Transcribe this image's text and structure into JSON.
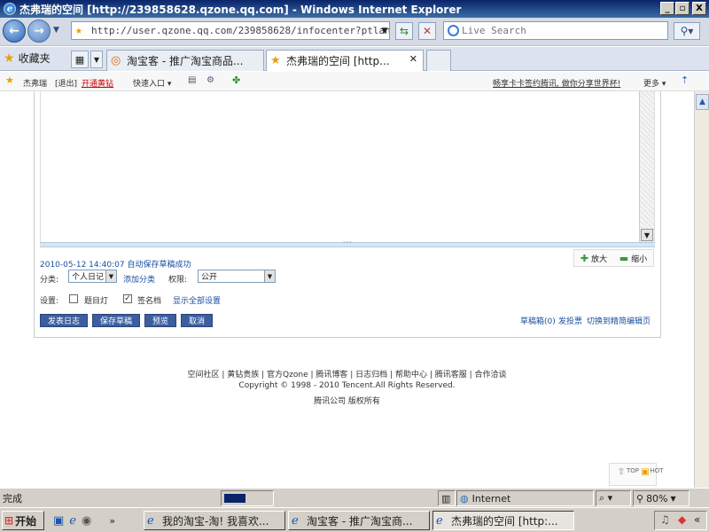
{
  "window": {
    "title": "杰弗瑞的空间 [http://239858628.qzone.qq.com] - Windows Internet Explorer",
    "min": "_",
    "max": "▫",
    "close": "X"
  },
  "addressbar": {
    "url": "http://user.qzone.qq.com/239858628/infocenter?ptlang=",
    "search_placeholder": "Live Search"
  },
  "tabs": {
    "favorites": "收藏夹",
    "items": [
      {
        "label": "淘宝客 - 推广淘宝商品..."
      },
      {
        "label": "杰弗瑞的空间 [http..."
      }
    ]
  },
  "qzone_bar": {
    "user": "杰弗瑞",
    "logout": "[退出]",
    "open_vip": "开通黄钻",
    "quick_entry": "快速入口 ▾",
    "promo": "畅享卡卡签约腾讯, 做你分享世界杯!",
    "more": "更多 ▾"
  },
  "editor": {
    "resize_grip": "˅˅˅",
    "zoom_in": "放大",
    "zoom_out": "缩小"
  },
  "form": {
    "autosave": "2010-05-12 14:40:07 自动保存草稿成功",
    "category_label": "分类:",
    "category_value": "个人日记",
    "add_category": "添加分类",
    "permission_label": "权限:",
    "permission_value": "公开",
    "settings_label": "设置:",
    "opt_title_light": "题目灯",
    "opt_signature": "签名档",
    "opt_show_all": "显示全部设置",
    "btn_publish": "发表日志",
    "btn_save_draft": "保存草稿",
    "btn_preview": "预览",
    "btn_cancel": "取消",
    "draft_box": "草稿箱(0)",
    "vote": "发投票",
    "switch_editor": "切换到精简编辑页"
  },
  "footer": {
    "links": [
      "空间社区",
      "黄钻贵族",
      "官方Qzone",
      "腾讯博客",
      "日志归档",
      "帮助中心",
      "腾讯客服",
      "合作洽谈"
    ],
    "copyright": "Copyright © 1998 - 2010 Tencent.All Rights Reserved.",
    "company": "腾讯公司 版权所有"
  },
  "back_to_top": {
    "top": "TOP",
    "hot": "HOT"
  },
  "statusbar": {
    "text": "完成",
    "zone": "Internet",
    "zoom": "80%"
  },
  "taskbar": {
    "start": "开始",
    "chevron": "»",
    "items": [
      {
        "label": "我的淘宝-淘! 我喜欢..."
      },
      {
        "label": "淘宝客 - 推广淘宝商..."
      },
      {
        "label": "杰弗瑞的空间 [http:..."
      }
    ],
    "tray_chevron": "«"
  }
}
